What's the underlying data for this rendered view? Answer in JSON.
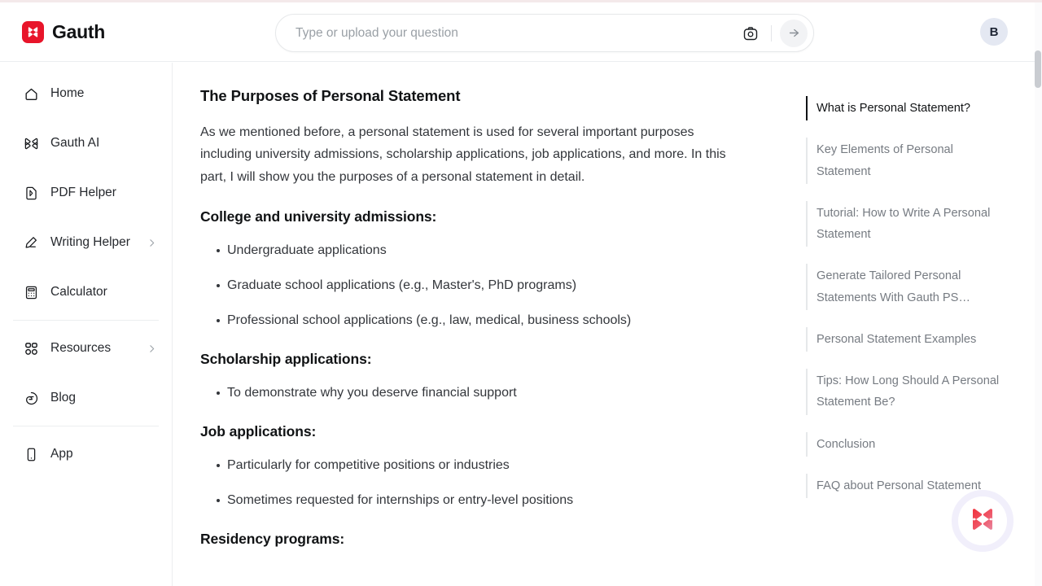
{
  "brand": {
    "name": "Gauth",
    "logo_color": "#e8152a",
    "logo_icon": "gauth-butterfly-logo"
  },
  "search": {
    "placeholder": "Type or upload your question",
    "value": "",
    "camera_icon": "camera-icon",
    "submit_icon": "arrow-right-icon"
  },
  "account": {
    "avatar_initial": "B",
    "avatar_bg": "#e4e8f2"
  },
  "sidebar": {
    "items": [
      {
        "label": "Home",
        "icon": "home-icon",
        "has_chevron": false
      },
      {
        "label": "Gauth AI",
        "icon": "gauth-ai-icon",
        "has_chevron": false
      },
      {
        "label": "PDF Helper",
        "icon": "pdf-file-icon",
        "has_chevron": false
      },
      {
        "label": "Writing Helper",
        "icon": "pen-icon",
        "has_chevron": true
      },
      {
        "label": "Calculator",
        "icon": "calculator-icon",
        "has_chevron": false
      },
      {
        "label": "Resources",
        "icon": "grid-apps-icon",
        "has_chevron": true
      },
      {
        "label": "Blog",
        "icon": "blog-icon",
        "has_chevron": false
      },
      {
        "label": "App",
        "icon": "mobile-phone-icon",
        "has_chevron": false
      }
    ]
  },
  "article": {
    "title": "The Purposes of Personal Statement",
    "intro": "As we mentioned before, a personal statement is used for several important purposes including university admissions, scholarship applications, job applications, and more. In this part, I will show you the purposes of a personal statement in detail.",
    "sections": [
      {
        "heading": "College and university admissions:",
        "bullets": [
          "Undergraduate applications",
          "Graduate school applications (e.g., Master's, PhD programs)",
          "Professional school applications (e.g., law, medical, business schools)"
        ]
      },
      {
        "heading": "Scholarship applications:",
        "bullets": [
          "To demonstrate why you deserve financial support"
        ]
      },
      {
        "heading": "Job applications:",
        "bullets": [
          "Particularly for competitive positions or industries",
          "Sometimes requested for internships or entry-level positions"
        ]
      },
      {
        "heading": "Residency programs:",
        "bullets": []
      }
    ]
  },
  "toc": {
    "items": [
      {
        "label": "What is Personal Statement?",
        "active": true
      },
      {
        "label": "Key Elements of Personal Statement",
        "active": false
      },
      {
        "label": "Tutorial: How to Write A Personal Statement",
        "active": false
      },
      {
        "label": "Generate Tailored Personal Statements With Gauth PS…",
        "active": false
      },
      {
        "label": "Personal Statement Examples",
        "active": false
      },
      {
        "label": "Tips: How Long Should A Personal Statement Be?",
        "active": false
      },
      {
        "label": "Conclusion",
        "active": false
      },
      {
        "label": "FAQ about Personal Statement",
        "active": false
      }
    ]
  },
  "fab": {
    "icon": "gauth-butterfly-logo",
    "ring_color": "#f1effb"
  }
}
